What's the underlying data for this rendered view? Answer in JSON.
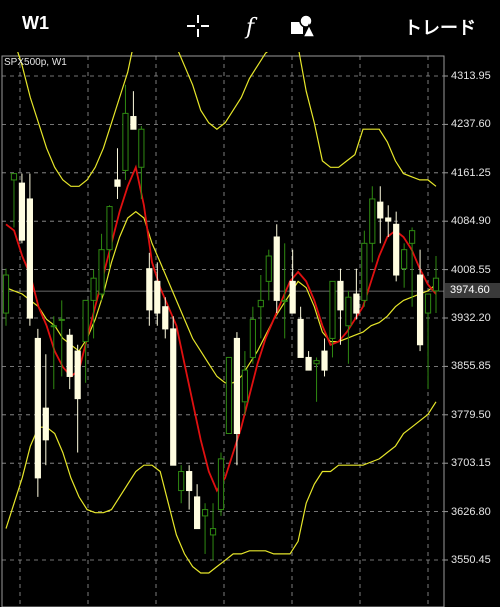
{
  "topbar": {
    "timeframe": "W1",
    "icons": [
      "crosshair-icon",
      "function-icon",
      "objects-icon"
    ],
    "trade_label": "トレード"
  },
  "chart_data": {
    "type": "candlestick",
    "symbol_label": "SPX500p, W1",
    "y_ticks": [
      "4313.95",
      "4237.60",
      "4161.25",
      "4084.90",
      "4008.55",
      "3932.20",
      "3855.85",
      "3779.50",
      "3703.15",
      "3626.80",
      "3550.45"
    ],
    "current_price": "3974.60",
    "ylim": [
      3520,
      4340
    ],
    "candles": [
      {
        "o": 3940,
        "h": 4010,
        "l": 3920,
        "c": 4000
      },
      {
        "o": 4150,
        "h": 4160,
        "l": 4075,
        "c": 4160
      },
      {
        "o": 4145,
        "h": 4160,
        "l": 4050,
        "c": 4055
      },
      {
        "o": 4120,
        "h": 4160,
        "l": 3920,
        "c": 3932
      },
      {
        "o": 3900,
        "h": 3915,
        "l": 3650,
        "c": 3680
      },
      {
        "o": 3790,
        "h": 3875,
        "l": 3700,
        "c": 3740
      },
      {
        "o": 3920,
        "h": 3935,
        "l": 3820,
        "c": 3920
      },
      {
        "o": 3930,
        "h": 3960,
        "l": 3840,
        "c": 3930
      },
      {
        "o": 3905,
        "h": 3915,
        "l": 3820,
        "c": 3840
      },
      {
        "o": 3880,
        "h": 3890,
        "l": 3720,
        "c": 3805
      },
      {
        "o": 3895,
        "h": 3960,
        "l": 3830,
        "c": 3960
      },
      {
        "o": 3960,
        "h": 4008,
        "l": 3900,
        "c": 3995
      },
      {
        "o": 3970,
        "h": 4065,
        "l": 3960,
        "c": 4040
      },
      {
        "o": 4040,
        "h": 4110,
        "l": 4010,
        "c": 4108
      },
      {
        "o": 4150,
        "h": 4200,
        "l": 4120,
        "c": 4140
      },
      {
        "o": 4165,
        "h": 4300,
        "l": 4150,
        "c": 4255
      },
      {
        "o": 4250,
        "h": 4290,
        "l": 4230,
        "c": 4230
      },
      {
        "o": 4170,
        "h": 4235,
        "l": 4120,
        "c": 4230
      },
      {
        "o": 4010,
        "h": 4035,
        "l": 3920,
        "c": 3945
      },
      {
        "o": 3990,
        "h": 4020,
        "l": 3920,
        "c": 3940
      },
      {
        "o": 3950,
        "h": 3965,
        "l": 3900,
        "c": 3915
      },
      {
        "o": 3915,
        "h": 3935,
        "l": 3700,
        "c": 3700
      },
      {
        "o": 3660,
        "h": 3700,
        "l": 3640,
        "c": 3690
      },
      {
        "o": 3690,
        "h": 3700,
        "l": 3630,
        "c": 3660
      },
      {
        "o": 3650,
        "h": 3670,
        "l": 3600,
        "c": 3600
      },
      {
        "o": 3620,
        "h": 3640,
        "l": 3560,
        "c": 3630
      },
      {
        "o": 3590,
        "h": 3640,
        "l": 3550,
        "c": 3600
      },
      {
        "o": 3630,
        "h": 3720,
        "l": 3620,
        "c": 3710
      },
      {
        "o": 3750,
        "h": 3870,
        "l": 3750,
        "c": 3870
      },
      {
        "o": 3900,
        "h": 3910,
        "l": 3700,
        "c": 3750
      },
      {
        "o": 3800,
        "h": 3880,
        "l": 3780,
        "c": 3850
      },
      {
        "o": 3870,
        "h": 3950,
        "l": 3860,
        "c": 3930
      },
      {
        "o": 3950,
        "h": 4000,
        "l": 3900,
        "c": 3960
      },
      {
        "o": 3990,
        "h": 4040,
        "l": 3960,
        "c": 4030
      },
      {
        "o": 4060,
        "h": 4080,
        "l": 3940,
        "c": 3960
      },
      {
        "o": 3960,
        "h": 4050,
        "l": 3900,
        "c": 3960
      },
      {
        "o": 3990,
        "h": 4040,
        "l": 3960,
        "c": 3940
      },
      {
        "o": 3930,
        "h": 3950,
        "l": 3880,
        "c": 3870
      },
      {
        "o": 3870,
        "h": 3880,
        "l": 3850,
        "c": 3850
      },
      {
        "o": 3860,
        "h": 3870,
        "l": 3800,
        "c": 3865
      },
      {
        "o": 3880,
        "h": 3900,
        "l": 3840,
        "c": 3850
      },
      {
        "o": 3900,
        "h": 3990,
        "l": 3870,
        "c": 3990
      },
      {
        "o": 3990,
        "h": 4010,
        "l": 3890,
        "c": 3945
      },
      {
        "o": 3920,
        "h": 3975,
        "l": 3860,
        "c": 3965
      },
      {
        "o": 3970,
        "h": 4010,
        "l": 3930,
        "c": 3940
      },
      {
        "o": 3960,
        "h": 4070,
        "l": 3950,
        "c": 4050
      },
      {
        "o": 4050,
        "h": 4140,
        "l": 4020,
        "c": 4120
      },
      {
        "o": 4115,
        "h": 4140,
        "l": 4050,
        "c": 4090
      },
      {
        "o": 4090,
        "h": 4110,
        "l": 4060,
        "c": 4085
      },
      {
        "o": 4080,
        "h": 4100,
        "l": 3990,
        "c": 4000
      },
      {
        "o": 4010,
        "h": 4050,
        "l": 3980,
        "c": 4040
      },
      {
        "o": 4050,
        "h": 4075,
        "l": 3950,
        "c": 4070
      },
      {
        "o": 4000,
        "h": 4040,
        "l": 3880,
        "c": 3890
      },
      {
        "o": 3940,
        "h": 3970,
        "l": 3820,
        "c": 3970
      },
      {
        "o": 3975,
        "h": 4030,
        "l": 3940,
        "c": 3995
      }
    ],
    "ma_line": [
      4080,
      4070,
      4030,
      4000,
      3950,
      3920,
      3880,
      3855,
      3840,
      3850,
      3900,
      3950,
      4000,
      4050,
      4100,
      4140,
      4170,
      4110,
      4020,
      3980,
      3950,
      3920,
      3860,
      3800,
      3740,
      3690,
      3660,
      3680,
      3720,
      3760,
      3810,
      3860,
      3900,
      3930,
      3960,
      3990,
      4005,
      3990,
      3960,
      3920,
      3890,
      3895,
      3910,
      3930,
      3950,
      3990,
      4030,
      4060,
      4070,
      4060,
      4040,
      4010,
      3985,
      3970
    ],
    "upper_band": [
      4400,
      4370,
      4330,
      4280,
      4240,
      4200,
      4170,
      4150,
      4140,
      4140,
      4150,
      4170,
      4200,
      4240,
      4280,
      4320,
      4380,
      4400,
      4400,
      4400,
      4380,
      4360,
      4330,
      4300,
      4260,
      4240,
      4230,
      4240,
      4260,
      4280,
      4310,
      4330,
      4350,
      4360,
      4370,
      4380,
      4360,
      4290,
      4240,
      4180,
      4170,
      4170,
      4180,
      4190,
      4230,
      4230,
      4230,
      4210,
      4180,
      4160,
      4155,
      4150,
      4150,
      4140
    ],
    "lower_band": [
      3600,
      3640,
      3680,
      3730,
      3760,
      3760,
      3750,
      3720,
      3680,
      3650,
      3630,
      3625,
      3625,
      3630,
      3650,
      3670,
      3690,
      3700,
      3700,
      3690,
      3640,
      3590,
      3560,
      3540,
      3530,
      3530,
      3540,
      3550,
      3560,
      3560,
      3565,
      3565,
      3565,
      3560,
      3560,
      3560,
      3580,
      3640,
      3670,
      3690,
      3690,
      3700,
      3700,
      3700,
      3700,
      3705,
      3710,
      3720,
      3730,
      3750,
      3760,
      3770,
      3780,
      3800
    ],
    "middle_band": [
      3980,
      3975,
      3970,
      3960,
      3950,
      3930,
      3920,
      3900,
      3890,
      3880,
      3900,
      3930,
      3970,
      4020,
      4060,
      4090,
      4100,
      4090,
      4050,
      4020,
      3990,
      3960,
      3930,
      3900,
      3880,
      3860,
      3840,
      3830,
      3830,
      3840,
      3860,
      3880,
      3905,
      3930,
      3950,
      3970,
      3990,
      3980,
      3950,
      3910,
      3895,
      3895,
      3900,
      3905,
      3910,
      3920,
      3925,
      3935,
      3950,
      3960,
      3965,
      3970,
      3975,
      3985
    ],
    "colors": {
      "bull": "#2f8a12",
      "bear": "#fffde0",
      "ma": "#e01010",
      "bands": "#e6e62a",
      "grid": "#9a9a9a"
    }
  }
}
